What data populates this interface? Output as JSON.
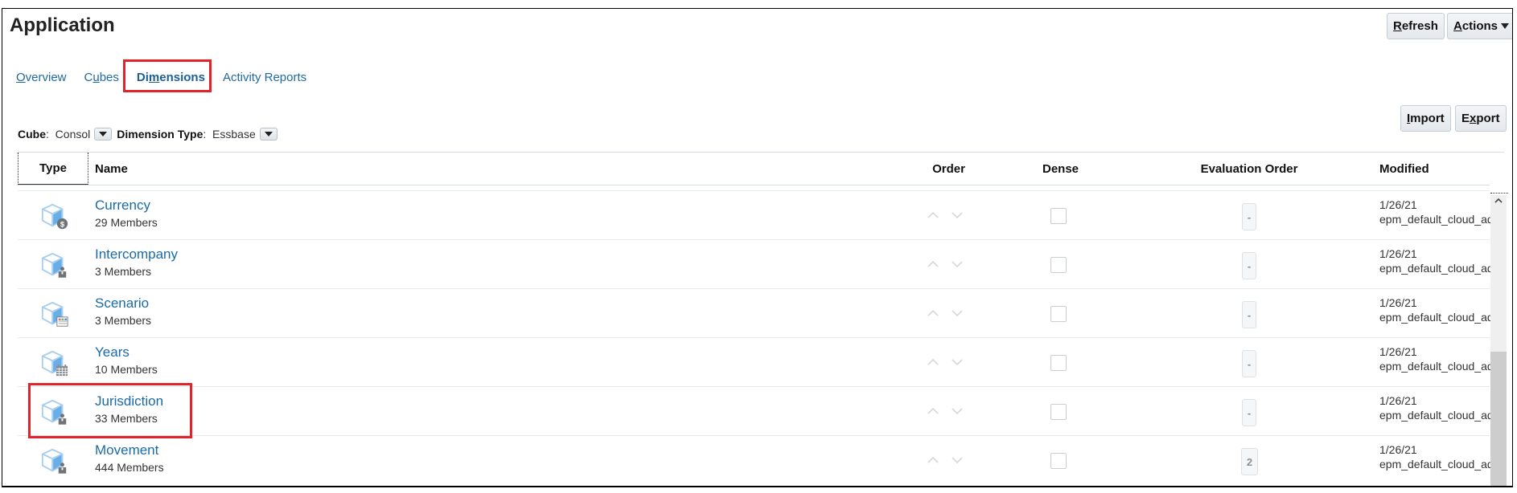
{
  "header": {
    "title": "Application",
    "refresh_button": {
      "pre": "",
      "key": "R",
      "post": "efresh"
    },
    "actions_button": {
      "pre": "",
      "key": "A",
      "post": "ctions"
    }
  },
  "tabs": [
    {
      "pre": "",
      "key": "O",
      "post": "verview",
      "active": false
    },
    {
      "pre": "C",
      "key": "u",
      "post": "bes",
      "active": false
    },
    {
      "pre": "Di",
      "key": "m",
      "post": "ensions",
      "active": true
    },
    {
      "pre": "Activity Reports",
      "key": "",
      "post": "",
      "active": false
    }
  ],
  "toolbar": {
    "import_button": {
      "pre": "",
      "key": "I",
      "post": "mport"
    },
    "export_button": {
      "pre": "E",
      "key": "x",
      "post": "port"
    }
  },
  "filters": {
    "cube_label": "Cube",
    "cube_value": "Consol",
    "dimension_type_label": "Dimension Type",
    "dimension_type_value": "Essbase"
  },
  "table": {
    "columns": {
      "type": "Type",
      "name": "Name",
      "order": "Order",
      "dense": "Dense",
      "evaluation_order": "Evaluation Order",
      "modified": "Modified"
    },
    "rows": [
      {
        "name": "Currency",
        "members": "29 Members",
        "badge": "currency",
        "dense": false,
        "evaluation_order": "-",
        "modified_date": "1/26/21",
        "modified_by": "epm_default_cloud_admin"
      },
      {
        "name": "Intercompany",
        "members": "3 Members",
        "badge": "person",
        "dense": false,
        "evaluation_order": "-",
        "modified_date": "1/26/21",
        "modified_by": "epm_default_cloud_admin"
      },
      {
        "name": "Scenario",
        "members": "3 Members",
        "badge": "scenario",
        "dense": false,
        "evaluation_order": "-",
        "modified_date": "1/26/21",
        "modified_by": "epm_default_cloud_admin"
      },
      {
        "name": "Years",
        "members": "10 Members",
        "badge": "calendar",
        "dense": false,
        "evaluation_order": "-",
        "modified_date": "1/26/21",
        "modified_by": "epm_default_cloud_admin"
      },
      {
        "name": "Jurisdiction",
        "members": "33 Members",
        "badge": "person",
        "dense": false,
        "evaluation_order": "-",
        "modified_date": "1/26/21",
        "modified_by": "epm_default_cloud_admin",
        "highlighted": true
      },
      {
        "name": "Movement",
        "members": "444 Members",
        "badge": "person",
        "dense": false,
        "evaluation_order": "2",
        "modified_date": "1/26/21",
        "modified_by": "epm_default_cloud_admin"
      }
    ]
  },
  "highlight_color": "#e3232a",
  "link_color": "#1a6aa8"
}
